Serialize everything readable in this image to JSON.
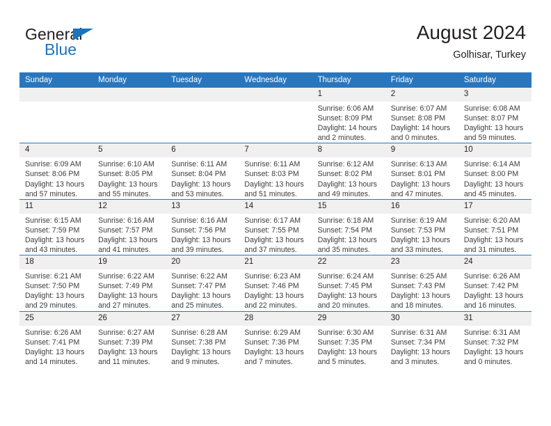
{
  "brand": {
    "name_part1": "General",
    "name_part2": "Blue",
    "triangle_color": "#1b74bc"
  },
  "header": {
    "title": "August 2024",
    "subtitle": "Golhisar, Turkey"
  },
  "colors": {
    "header_blue": "#2a76bd",
    "daynum_band": "#f0f0f0",
    "text": "#231f20"
  },
  "weekday_headers": [
    "Sunday",
    "Monday",
    "Tuesday",
    "Wednesday",
    "Thursday",
    "Friday",
    "Saturday"
  ],
  "weeks": [
    [
      {
        "day": "",
        "empty": true
      },
      {
        "day": "",
        "empty": true
      },
      {
        "day": "",
        "empty": true
      },
      {
        "day": "",
        "empty": true
      },
      {
        "day": "1",
        "sunrise": "Sunrise: 6:06 AM",
        "sunset": "Sunset: 8:09 PM",
        "daylight1": "Daylight: 14 hours",
        "daylight2": "and 2 minutes."
      },
      {
        "day": "2",
        "sunrise": "Sunrise: 6:07 AM",
        "sunset": "Sunset: 8:08 PM",
        "daylight1": "Daylight: 14 hours",
        "daylight2": "and 0 minutes."
      },
      {
        "day": "3",
        "sunrise": "Sunrise: 6:08 AM",
        "sunset": "Sunset: 8:07 PM",
        "daylight1": "Daylight: 13 hours",
        "daylight2": "and 59 minutes."
      }
    ],
    [
      {
        "day": "4",
        "sunrise": "Sunrise: 6:09 AM",
        "sunset": "Sunset: 8:06 PM",
        "daylight1": "Daylight: 13 hours",
        "daylight2": "and 57 minutes."
      },
      {
        "day": "5",
        "sunrise": "Sunrise: 6:10 AM",
        "sunset": "Sunset: 8:05 PM",
        "daylight1": "Daylight: 13 hours",
        "daylight2": "and 55 minutes."
      },
      {
        "day": "6",
        "sunrise": "Sunrise: 6:11 AM",
        "sunset": "Sunset: 8:04 PM",
        "daylight1": "Daylight: 13 hours",
        "daylight2": "and 53 minutes."
      },
      {
        "day": "7",
        "sunrise": "Sunrise: 6:11 AM",
        "sunset": "Sunset: 8:03 PM",
        "daylight1": "Daylight: 13 hours",
        "daylight2": "and 51 minutes."
      },
      {
        "day": "8",
        "sunrise": "Sunrise: 6:12 AM",
        "sunset": "Sunset: 8:02 PM",
        "daylight1": "Daylight: 13 hours",
        "daylight2": "and 49 minutes."
      },
      {
        "day": "9",
        "sunrise": "Sunrise: 6:13 AM",
        "sunset": "Sunset: 8:01 PM",
        "daylight1": "Daylight: 13 hours",
        "daylight2": "and 47 minutes."
      },
      {
        "day": "10",
        "sunrise": "Sunrise: 6:14 AM",
        "sunset": "Sunset: 8:00 PM",
        "daylight1": "Daylight: 13 hours",
        "daylight2": "and 45 minutes."
      }
    ],
    [
      {
        "day": "11",
        "sunrise": "Sunrise: 6:15 AM",
        "sunset": "Sunset: 7:59 PM",
        "daylight1": "Daylight: 13 hours",
        "daylight2": "and 43 minutes."
      },
      {
        "day": "12",
        "sunrise": "Sunrise: 6:16 AM",
        "sunset": "Sunset: 7:57 PM",
        "daylight1": "Daylight: 13 hours",
        "daylight2": "and 41 minutes."
      },
      {
        "day": "13",
        "sunrise": "Sunrise: 6:16 AM",
        "sunset": "Sunset: 7:56 PM",
        "daylight1": "Daylight: 13 hours",
        "daylight2": "and 39 minutes."
      },
      {
        "day": "14",
        "sunrise": "Sunrise: 6:17 AM",
        "sunset": "Sunset: 7:55 PM",
        "daylight1": "Daylight: 13 hours",
        "daylight2": "and 37 minutes."
      },
      {
        "day": "15",
        "sunrise": "Sunrise: 6:18 AM",
        "sunset": "Sunset: 7:54 PM",
        "daylight1": "Daylight: 13 hours",
        "daylight2": "and 35 minutes."
      },
      {
        "day": "16",
        "sunrise": "Sunrise: 6:19 AM",
        "sunset": "Sunset: 7:53 PM",
        "daylight1": "Daylight: 13 hours",
        "daylight2": "and 33 minutes."
      },
      {
        "day": "17",
        "sunrise": "Sunrise: 6:20 AM",
        "sunset": "Sunset: 7:51 PM",
        "daylight1": "Daylight: 13 hours",
        "daylight2": "and 31 minutes."
      }
    ],
    [
      {
        "day": "18",
        "sunrise": "Sunrise: 6:21 AM",
        "sunset": "Sunset: 7:50 PM",
        "daylight1": "Daylight: 13 hours",
        "daylight2": "and 29 minutes."
      },
      {
        "day": "19",
        "sunrise": "Sunrise: 6:22 AM",
        "sunset": "Sunset: 7:49 PM",
        "daylight1": "Daylight: 13 hours",
        "daylight2": "and 27 minutes."
      },
      {
        "day": "20",
        "sunrise": "Sunrise: 6:22 AM",
        "sunset": "Sunset: 7:47 PM",
        "daylight1": "Daylight: 13 hours",
        "daylight2": "and 25 minutes."
      },
      {
        "day": "21",
        "sunrise": "Sunrise: 6:23 AM",
        "sunset": "Sunset: 7:46 PM",
        "daylight1": "Daylight: 13 hours",
        "daylight2": "and 22 minutes."
      },
      {
        "day": "22",
        "sunrise": "Sunrise: 6:24 AM",
        "sunset": "Sunset: 7:45 PM",
        "daylight1": "Daylight: 13 hours",
        "daylight2": "and 20 minutes."
      },
      {
        "day": "23",
        "sunrise": "Sunrise: 6:25 AM",
        "sunset": "Sunset: 7:43 PM",
        "daylight1": "Daylight: 13 hours",
        "daylight2": "and 18 minutes."
      },
      {
        "day": "24",
        "sunrise": "Sunrise: 6:26 AM",
        "sunset": "Sunset: 7:42 PM",
        "daylight1": "Daylight: 13 hours",
        "daylight2": "and 16 minutes."
      }
    ],
    [
      {
        "day": "25",
        "sunrise": "Sunrise: 6:26 AM",
        "sunset": "Sunset: 7:41 PM",
        "daylight1": "Daylight: 13 hours",
        "daylight2": "and 14 minutes."
      },
      {
        "day": "26",
        "sunrise": "Sunrise: 6:27 AM",
        "sunset": "Sunset: 7:39 PM",
        "daylight1": "Daylight: 13 hours",
        "daylight2": "and 11 minutes."
      },
      {
        "day": "27",
        "sunrise": "Sunrise: 6:28 AM",
        "sunset": "Sunset: 7:38 PM",
        "daylight1": "Daylight: 13 hours",
        "daylight2": "and 9 minutes."
      },
      {
        "day": "28",
        "sunrise": "Sunrise: 6:29 AM",
        "sunset": "Sunset: 7:36 PM",
        "daylight1": "Daylight: 13 hours",
        "daylight2": "and 7 minutes."
      },
      {
        "day": "29",
        "sunrise": "Sunrise: 6:30 AM",
        "sunset": "Sunset: 7:35 PM",
        "daylight1": "Daylight: 13 hours",
        "daylight2": "and 5 minutes."
      },
      {
        "day": "30",
        "sunrise": "Sunrise: 6:31 AM",
        "sunset": "Sunset: 7:34 PM",
        "daylight1": "Daylight: 13 hours",
        "daylight2": "and 3 minutes."
      },
      {
        "day": "31",
        "sunrise": "Sunrise: 6:31 AM",
        "sunset": "Sunset: 7:32 PM",
        "daylight1": "Daylight: 13 hours",
        "daylight2": "and 0 minutes."
      }
    ]
  ]
}
